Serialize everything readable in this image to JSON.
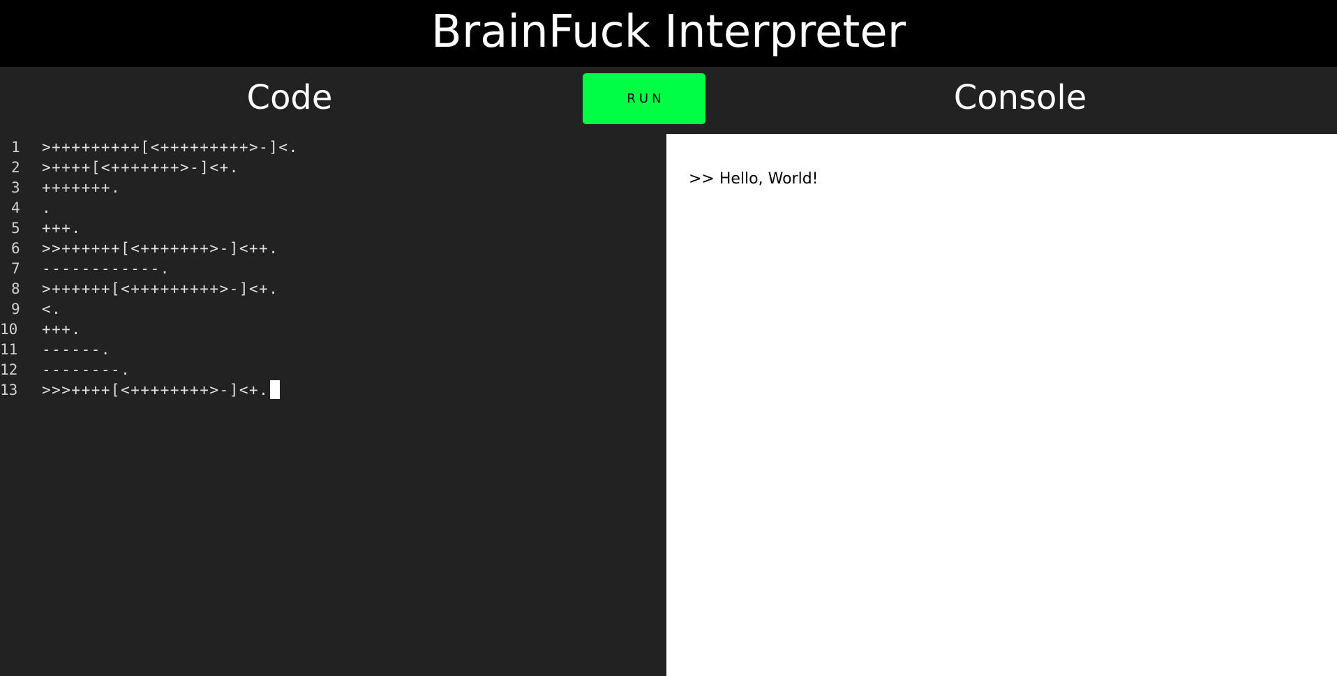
{
  "header": {
    "title": "BrainFuck Interpreter"
  },
  "toolbar": {
    "code_label": "Code",
    "run_label": "RUN",
    "console_label": "Console"
  },
  "editor": {
    "lines": [
      {
        "number": "1",
        "text": ">+++++++++[<+++++++++>-]<."
      },
      {
        "number": "2",
        "text": ">++++[<+++++++>-]<+."
      },
      {
        "number": "3",
        "text": "+++++++."
      },
      {
        "number": "4",
        "text": "."
      },
      {
        "number": "5",
        "text": "+++."
      },
      {
        "number": "6",
        "text": ">>++++++[<+++++++>-]<++."
      },
      {
        "number": "7",
        "text": "------------."
      },
      {
        "number": "8",
        "text": ">++++++[<+++++++++>-]<+."
      },
      {
        "number": "9",
        "text": "<."
      },
      {
        "number": "10",
        "text": "+++."
      },
      {
        "number": "11",
        "text": "------."
      },
      {
        "number": "12",
        "text": "--------."
      },
      {
        "number": "13",
        "text": ">>>++++[<++++++++>-]<+."
      }
    ]
  },
  "console": {
    "output": ">> Hello, World!"
  },
  "colors": {
    "header_bg": "#000000",
    "panel_bg": "#222222",
    "run_button": "#00ff44",
    "console_bg": "#ffffff"
  }
}
